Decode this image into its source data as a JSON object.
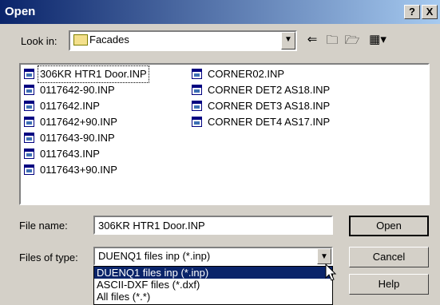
{
  "window": {
    "title": "Open",
    "help_btn": "?",
    "close_btn": "X"
  },
  "lookin": {
    "label": "Look in:",
    "value": "Facades",
    "folder_icon": "folder-icon"
  },
  "toolbar": {
    "back": "back-icon",
    "up": "up-folder-icon",
    "newfolder": "new-folder-icon",
    "views": "views-menu-icon"
  },
  "files": {
    "col1": [
      "306KR HTR1 Door.INP",
      "0117642-90.INP",
      "0117642.INP",
      "0117642+90.INP",
      "0117643-90.INP",
      "0117643.INP",
      "0117643+90.INP"
    ],
    "col2": [
      "CORNER02.INP",
      "CORNER DET2 AS18.INP",
      "CORNER DET3 AS18.INP",
      "CORNER DET4 AS17.INP"
    ]
  },
  "filename": {
    "label": "File name:",
    "value": "306KR HTR1 Door.INP"
  },
  "filetype": {
    "label": "Files of type:",
    "value": "DUENQ1 files inp (*.inp)",
    "options": [
      "DUENQ1 files inp (*.inp)",
      "ASCII-DXF files (*.dxf)",
      "All files (*.*)"
    ]
  },
  "buttons": {
    "open": "Open",
    "cancel": "Cancel",
    "help": "Help"
  }
}
